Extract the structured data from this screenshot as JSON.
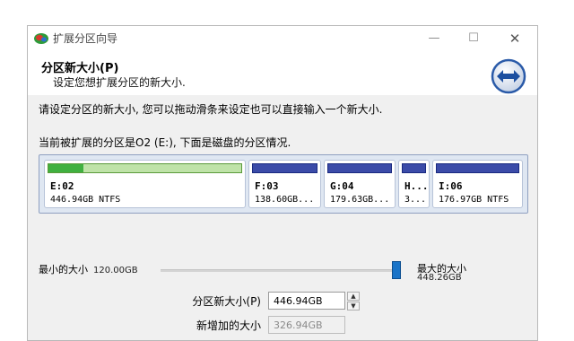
{
  "window": {
    "title": "扩展分区向导",
    "controls": {
      "minimize": "—",
      "maximize": "☐",
      "close": "✕"
    }
  },
  "header": {
    "title": "分区新大小(P)",
    "subtitle": "设定您想扩展分区的新大小."
  },
  "body": {
    "instruction": "请设定分区的新大小, 您可以拖动滑条来设定也可以直接输入一个新大小.",
    "disk_desc": "当前被扩展的分区是O2 (E:), 下面是磁盘的分区情况."
  },
  "partitions": [
    {
      "label": "E:02",
      "info": "446.94GB NTFS",
      "active": true,
      "used_fraction": 0.18
    },
    {
      "label": "F:03",
      "info": "138.60GB...",
      "active": false
    },
    {
      "label": "G:04",
      "info": "179.63GB...",
      "active": false
    },
    {
      "label": "H...",
      "info": "3...",
      "active": false
    },
    {
      "label": "I:06",
      "info": "176.97GB NTFS",
      "active": false
    }
  ],
  "slider": {
    "min_label": "最小的大小",
    "min_value": "120.00GB",
    "max_label": "最大的大小",
    "max_value": "448.26GB",
    "position_fraction": 0.99
  },
  "fields": {
    "new_size_label": "分区新大小(P)",
    "new_size_value": "446.94GB",
    "added_label": "新增加的大小",
    "added_value": "326.94GB"
  },
  "colors": {
    "accent": "#1a74c8",
    "partition_bar": "#3b4ba8",
    "active_fill": "#40b040"
  }
}
